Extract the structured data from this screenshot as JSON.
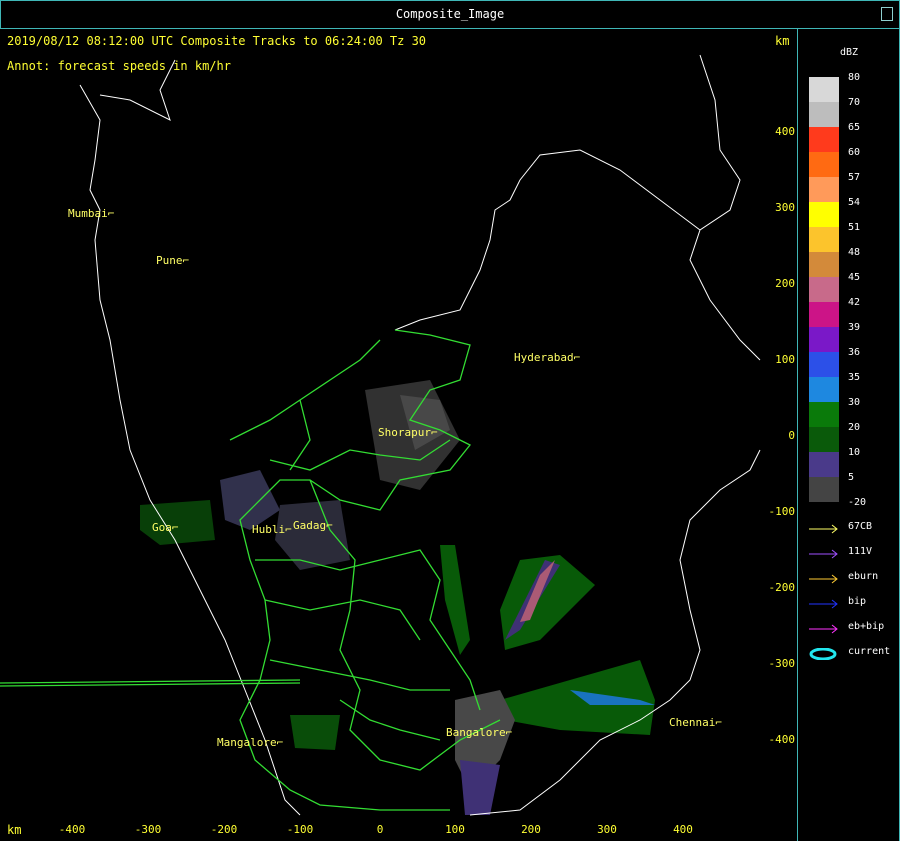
{
  "window": {
    "title": "Composite_Image"
  },
  "header": {
    "line1": "2019/08/12 08:12:00 UTC Composite Tracks to 06:24:00 Tz 30",
    "annot": "Annot: forecast speeds in km/hr",
    "km_top": "km",
    "km_bottom": "km"
  },
  "cities": [
    {
      "name": "Mumbai"
    },
    {
      "name": "Pune"
    },
    {
      "name": "Hyderabad"
    },
    {
      "name": "Shorapur"
    },
    {
      "name": "Goa"
    },
    {
      "name": "Hubli"
    },
    {
      "name": "Gadag"
    },
    {
      "name": "Mangalore"
    },
    {
      "name": "Bangalore"
    },
    {
      "name": "Chennai"
    }
  ],
  "y_axis": [
    "400",
    "300",
    "200",
    "100",
    "0",
    "-100",
    "-200",
    "-300",
    "-400"
  ],
  "x_axis": [
    "-400",
    "-300",
    "-200",
    "-100",
    "0",
    "100",
    "200",
    "300",
    "400"
  ],
  "legend": {
    "unit": "dBZ",
    "levels": [
      {
        "label": "80",
        "color": "#d8d8d8"
      },
      {
        "label": "70",
        "color": "#bdbdbd"
      },
      {
        "label": "65",
        "color": "#ff3a1c"
      },
      {
        "label": "60",
        "color": "#ff6a12"
      },
      {
        "label": "57",
        "color": "#ff9a5a"
      },
      {
        "label": "54",
        "color": "#ffff00"
      },
      {
        "label": "51",
        "color": "#fcc42c"
      },
      {
        "label": "48",
        "color": "#d38a3a"
      },
      {
        "label": "45",
        "color": "#c86a8a"
      },
      {
        "label": "42",
        "color": "#cc1487"
      },
      {
        "label": "39",
        "color": "#7a18c8"
      },
      {
        "label": "36",
        "color": "#2c50e8"
      },
      {
        "label": "35",
        "color": "#1e88e0"
      },
      {
        "label": "30",
        "color": "#0a7a0a"
      },
      {
        "label": "20",
        "color": "#0a5a0a"
      },
      {
        "label": "10",
        "color": "#4a3a8a"
      },
      {
        "label": "5",
        "color": "#444444"
      },
      {
        "label": "-20",
        "color": "#000000"
      }
    ],
    "tracks": [
      {
        "label": "67CB",
        "color": "#ffff66"
      },
      {
        "label": "111V",
        "color": "#a050ff"
      },
      {
        "label": "eburn",
        "color": "#ffcc33"
      },
      {
        "label": "bip",
        "color": "#2233ff"
      },
      {
        "label": "eb+bip",
        "color": "#ff33ff"
      },
      {
        "label": "current",
        "color": "#22e6ee"
      }
    ]
  }
}
